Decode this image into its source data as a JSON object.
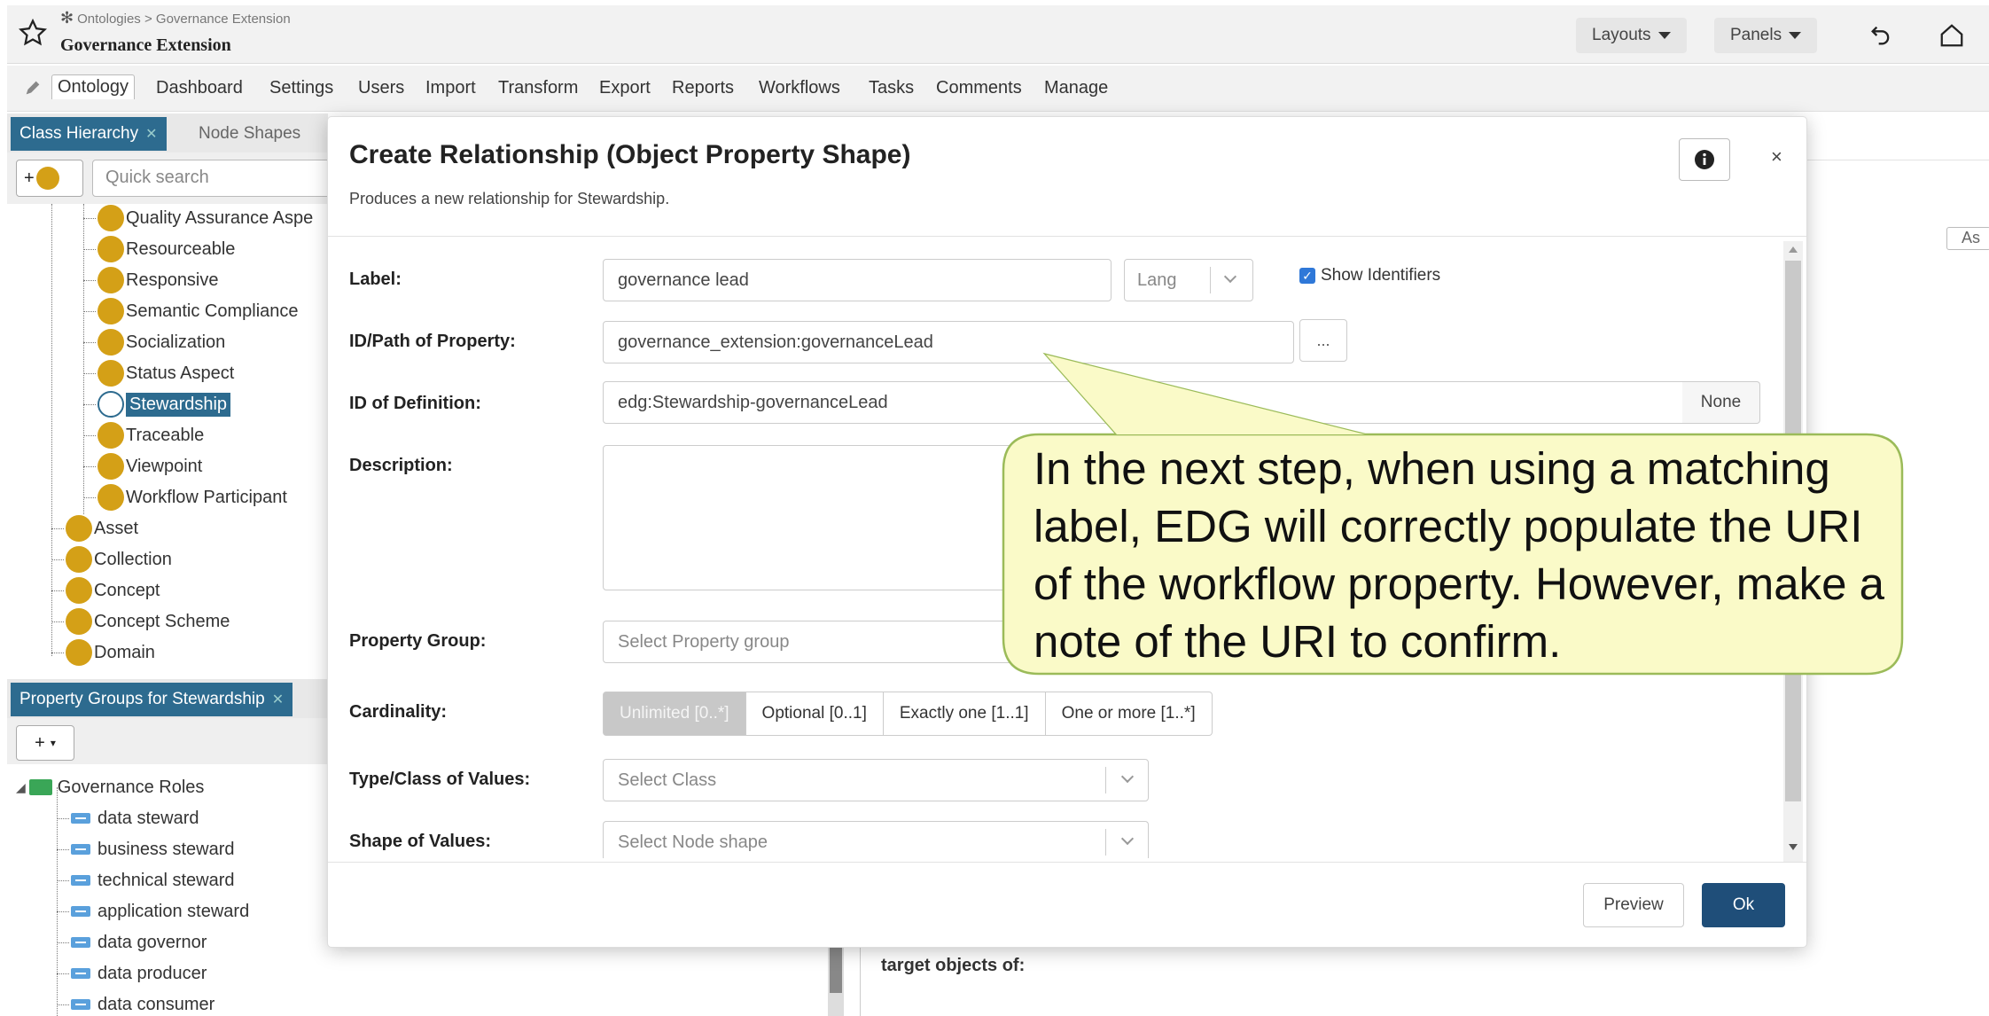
{
  "header": {
    "breadcrumb": "Ontologies > Governance Extension",
    "title": "Governance Extension",
    "layouts_label": "Layouts",
    "panels_label": "Panels"
  },
  "menu": {
    "items": [
      "Ontology",
      "Dashboard",
      "Settings",
      "Users",
      "Import",
      "Transform",
      "Export",
      "Reports",
      "Workflows",
      "Tasks",
      "Comments",
      "Manage"
    ]
  },
  "class_pane": {
    "tab_active": "Class Hierarchy",
    "tab_inactive": "Node Shapes",
    "search_placeholder": "Quick search",
    "items": [
      "Quality Assurance Aspe",
      "Resourceable",
      "Responsive",
      "Semantic Compliance",
      "Socialization",
      "Status Aspect",
      "Stewardship",
      "Traceable",
      "Viewpoint",
      "Workflow Participant",
      "Asset",
      "Collection",
      "Concept",
      "Concept Scheme",
      "Domain"
    ],
    "selected": "Stewardship"
  },
  "property_pane": {
    "tab_active": "Property Groups for Stewardship",
    "add_label": "+",
    "group": "Governance Roles",
    "items": [
      "data steward",
      "business steward",
      "technical steward",
      "application steward",
      "data governor",
      "data producer",
      "data consumer"
    ]
  },
  "background": {
    "target_objects": "target objects of:",
    "right_button": "As"
  },
  "modal": {
    "title": "Create Relationship (Object Property Shape)",
    "subtitle": "Produces a new relationship for Stewardship.",
    "close_label": "×",
    "label_label": "Label:",
    "label_value": "governance lead",
    "lang_placeholder": "Lang",
    "show_identifiers": "Show Identifiers",
    "id_label": "ID/Path of Property:",
    "id_value": "governance_extension:governanceLead",
    "dots_label": "...",
    "def_label": "ID of Definition:",
    "def_value": "edg:Stewardship-governanceLead",
    "none_label": "None",
    "desc_label": "Description:",
    "group_label": "Property Group:",
    "group_placeholder": "Select Property group",
    "card_label": "Cardinality:",
    "card_options": [
      "Unlimited [0..*]",
      "Optional [0..1]",
      "Exactly one [1..1]",
      "One or more [1..*]"
    ],
    "type_label": "Type/Class of Values:",
    "type_placeholder": "Select Class",
    "shape_label": "Shape of Values:",
    "shape_placeholder": "Select Node shape",
    "preview_label": "Preview",
    "ok_label": "Ok"
  },
  "callout": {
    "text": "In the next step, when using a matching label, EDG will correctly populate the URI of the workflow property. However, make a note of the URI to confirm."
  },
  "colors": {
    "accent": "#2d6b8f",
    "ok_button": "#1f4e79",
    "class_dot": "#d4a017",
    "callout_fill": "#fafac8",
    "callout_border": "#9bbb59"
  },
  "icons": [
    "star-icon",
    "undo-icon",
    "home-icon",
    "pencil-icon",
    "info-icon",
    "close-icon",
    "checkbox-icon",
    "chevron-down-icon"
  ]
}
